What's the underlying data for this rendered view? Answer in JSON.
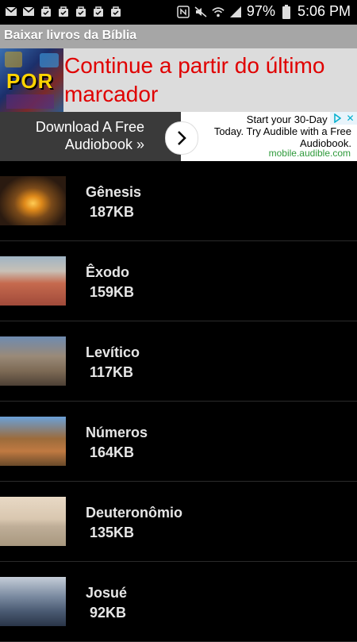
{
  "status_bar": {
    "battery": "97%",
    "time": "5:06 PM",
    "left_icons": [
      "mail-icon",
      "mail-icon",
      "bag-icon",
      "bag-icon",
      "bag-icon",
      "bag-icon",
      "bag-icon"
    ],
    "right_icons": [
      "nfc-icon",
      "mute-icon",
      "wifi-icon",
      "signal-icon",
      "battery-icon"
    ]
  },
  "app": {
    "title": "Baixar livros da Bíblia"
  },
  "bookmark": {
    "logo_text": "POR",
    "text": "Continue a partir do último marcador",
    "text_color": "#e00000"
  },
  "ad": {
    "left_line1": "Download A Free",
    "left_line2": "Audiobook »",
    "right_line1": "Start your 30-Day Free",
    "right_line2": "Today. Try Audible with a Free",
    "right_line3": "Audiobook.",
    "url": "mobile.audible.com",
    "url_color": "#2e9a3a"
  },
  "books": [
    {
      "title": "Gênesis",
      "size": "187KB"
    },
    {
      "title": "Êxodo",
      "size": "159KB"
    },
    {
      "title": "Levítico",
      "size": "117KB"
    },
    {
      "title": "Números",
      "size": "164KB"
    },
    {
      "title": "Deuteronômio",
      "size": "135KB"
    },
    {
      "title": "Josué",
      "size": "92KB"
    }
  ]
}
